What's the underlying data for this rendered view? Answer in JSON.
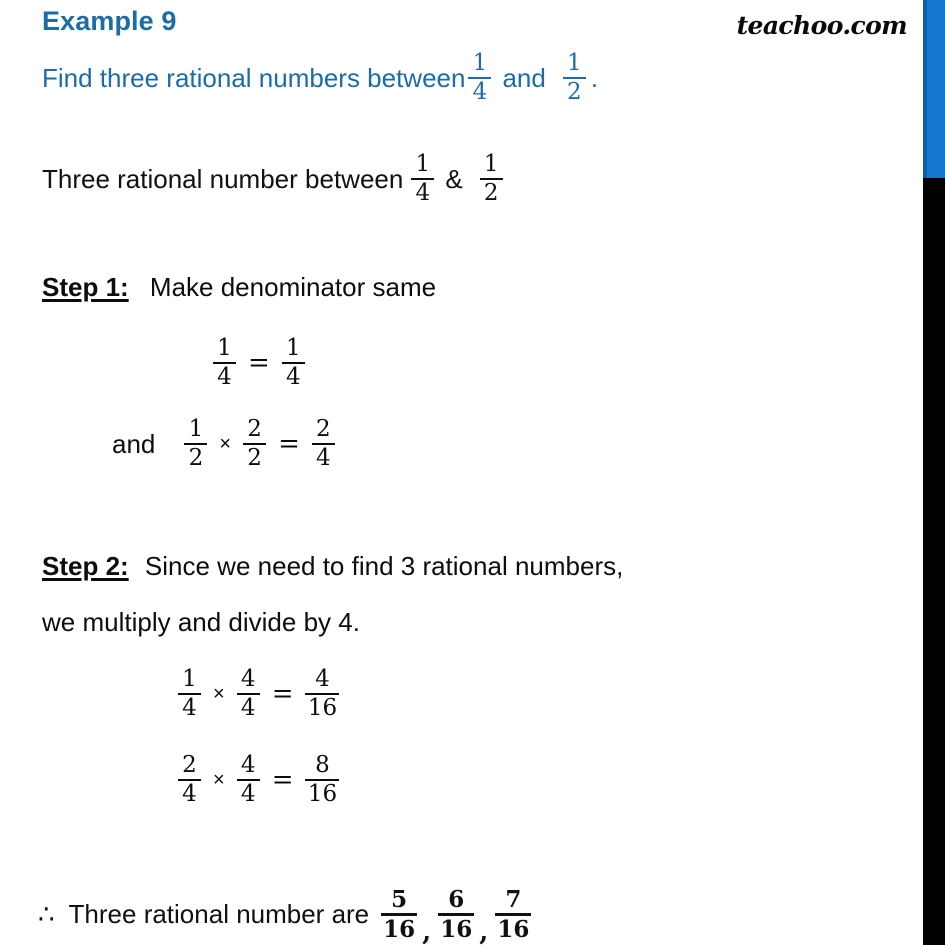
{
  "document": {
    "brand": "teachoo.com",
    "example_title": "Example 9"
  },
  "question": {
    "prefix": "Find three rational numbers between",
    "frac_a": {
      "num": "1",
      "den": "4"
    },
    "joiner": "and",
    "frac_b": {
      "num": "1",
      "den": "2"
    },
    "suffix": "."
  },
  "restatement": {
    "prefix": "Three rational number between",
    "frac_a": {
      "num": "1",
      "den": "4"
    },
    "joiner": "&",
    "frac_b": {
      "num": "1",
      "den": "2"
    }
  },
  "step1": {
    "tag": "Step 1:",
    "text": "Make denominator same",
    "equations": [
      {
        "lead": "",
        "left": {
          "num": "1",
          "den": "4"
        },
        "op1": "",
        "mid": null,
        "op2": "=",
        "right": {
          "num": "1",
          "den": "4"
        }
      },
      {
        "lead": "and",
        "left": {
          "num": "1",
          "den": "2"
        },
        "op1": "×",
        "mid": {
          "num": "2",
          "den": "2"
        },
        "op2": "=",
        "right": {
          "num": "2",
          "den": "4"
        }
      }
    ]
  },
  "step2": {
    "tag": "Step 2:",
    "text_line1": "Since we need to find 3 rational numbers,",
    "text_line2": "we multiply and divide by 4.",
    "equations": [
      {
        "left": {
          "num": "1",
          "den": "4"
        },
        "op1": "×",
        "mid": {
          "num": "4",
          "den": "4"
        },
        "op2": "=",
        "right": {
          "num": "4",
          "den": "16"
        }
      },
      {
        "left": {
          "num": "2",
          "den": "4"
        },
        "op1": "×",
        "mid": {
          "num": "4",
          "den": "4"
        },
        "op2": "=",
        "right": {
          "num": "8",
          "den": "16"
        }
      }
    ]
  },
  "conclusion": {
    "symbol": "∴",
    "text": "Three rational number are",
    "answers": [
      {
        "num": "5",
        "den": "16"
      },
      {
        "num": "6",
        "den": "16"
      },
      {
        "num": "7",
        "den": "16"
      }
    ],
    "separator": ","
  },
  "colors": {
    "heading_blue": "#1B6CA8",
    "edge_bar_blue": "#1378CE",
    "edge_bar_black": "#000000",
    "body_text": "#0d0d0d",
    "background": "#ffffff"
  }
}
